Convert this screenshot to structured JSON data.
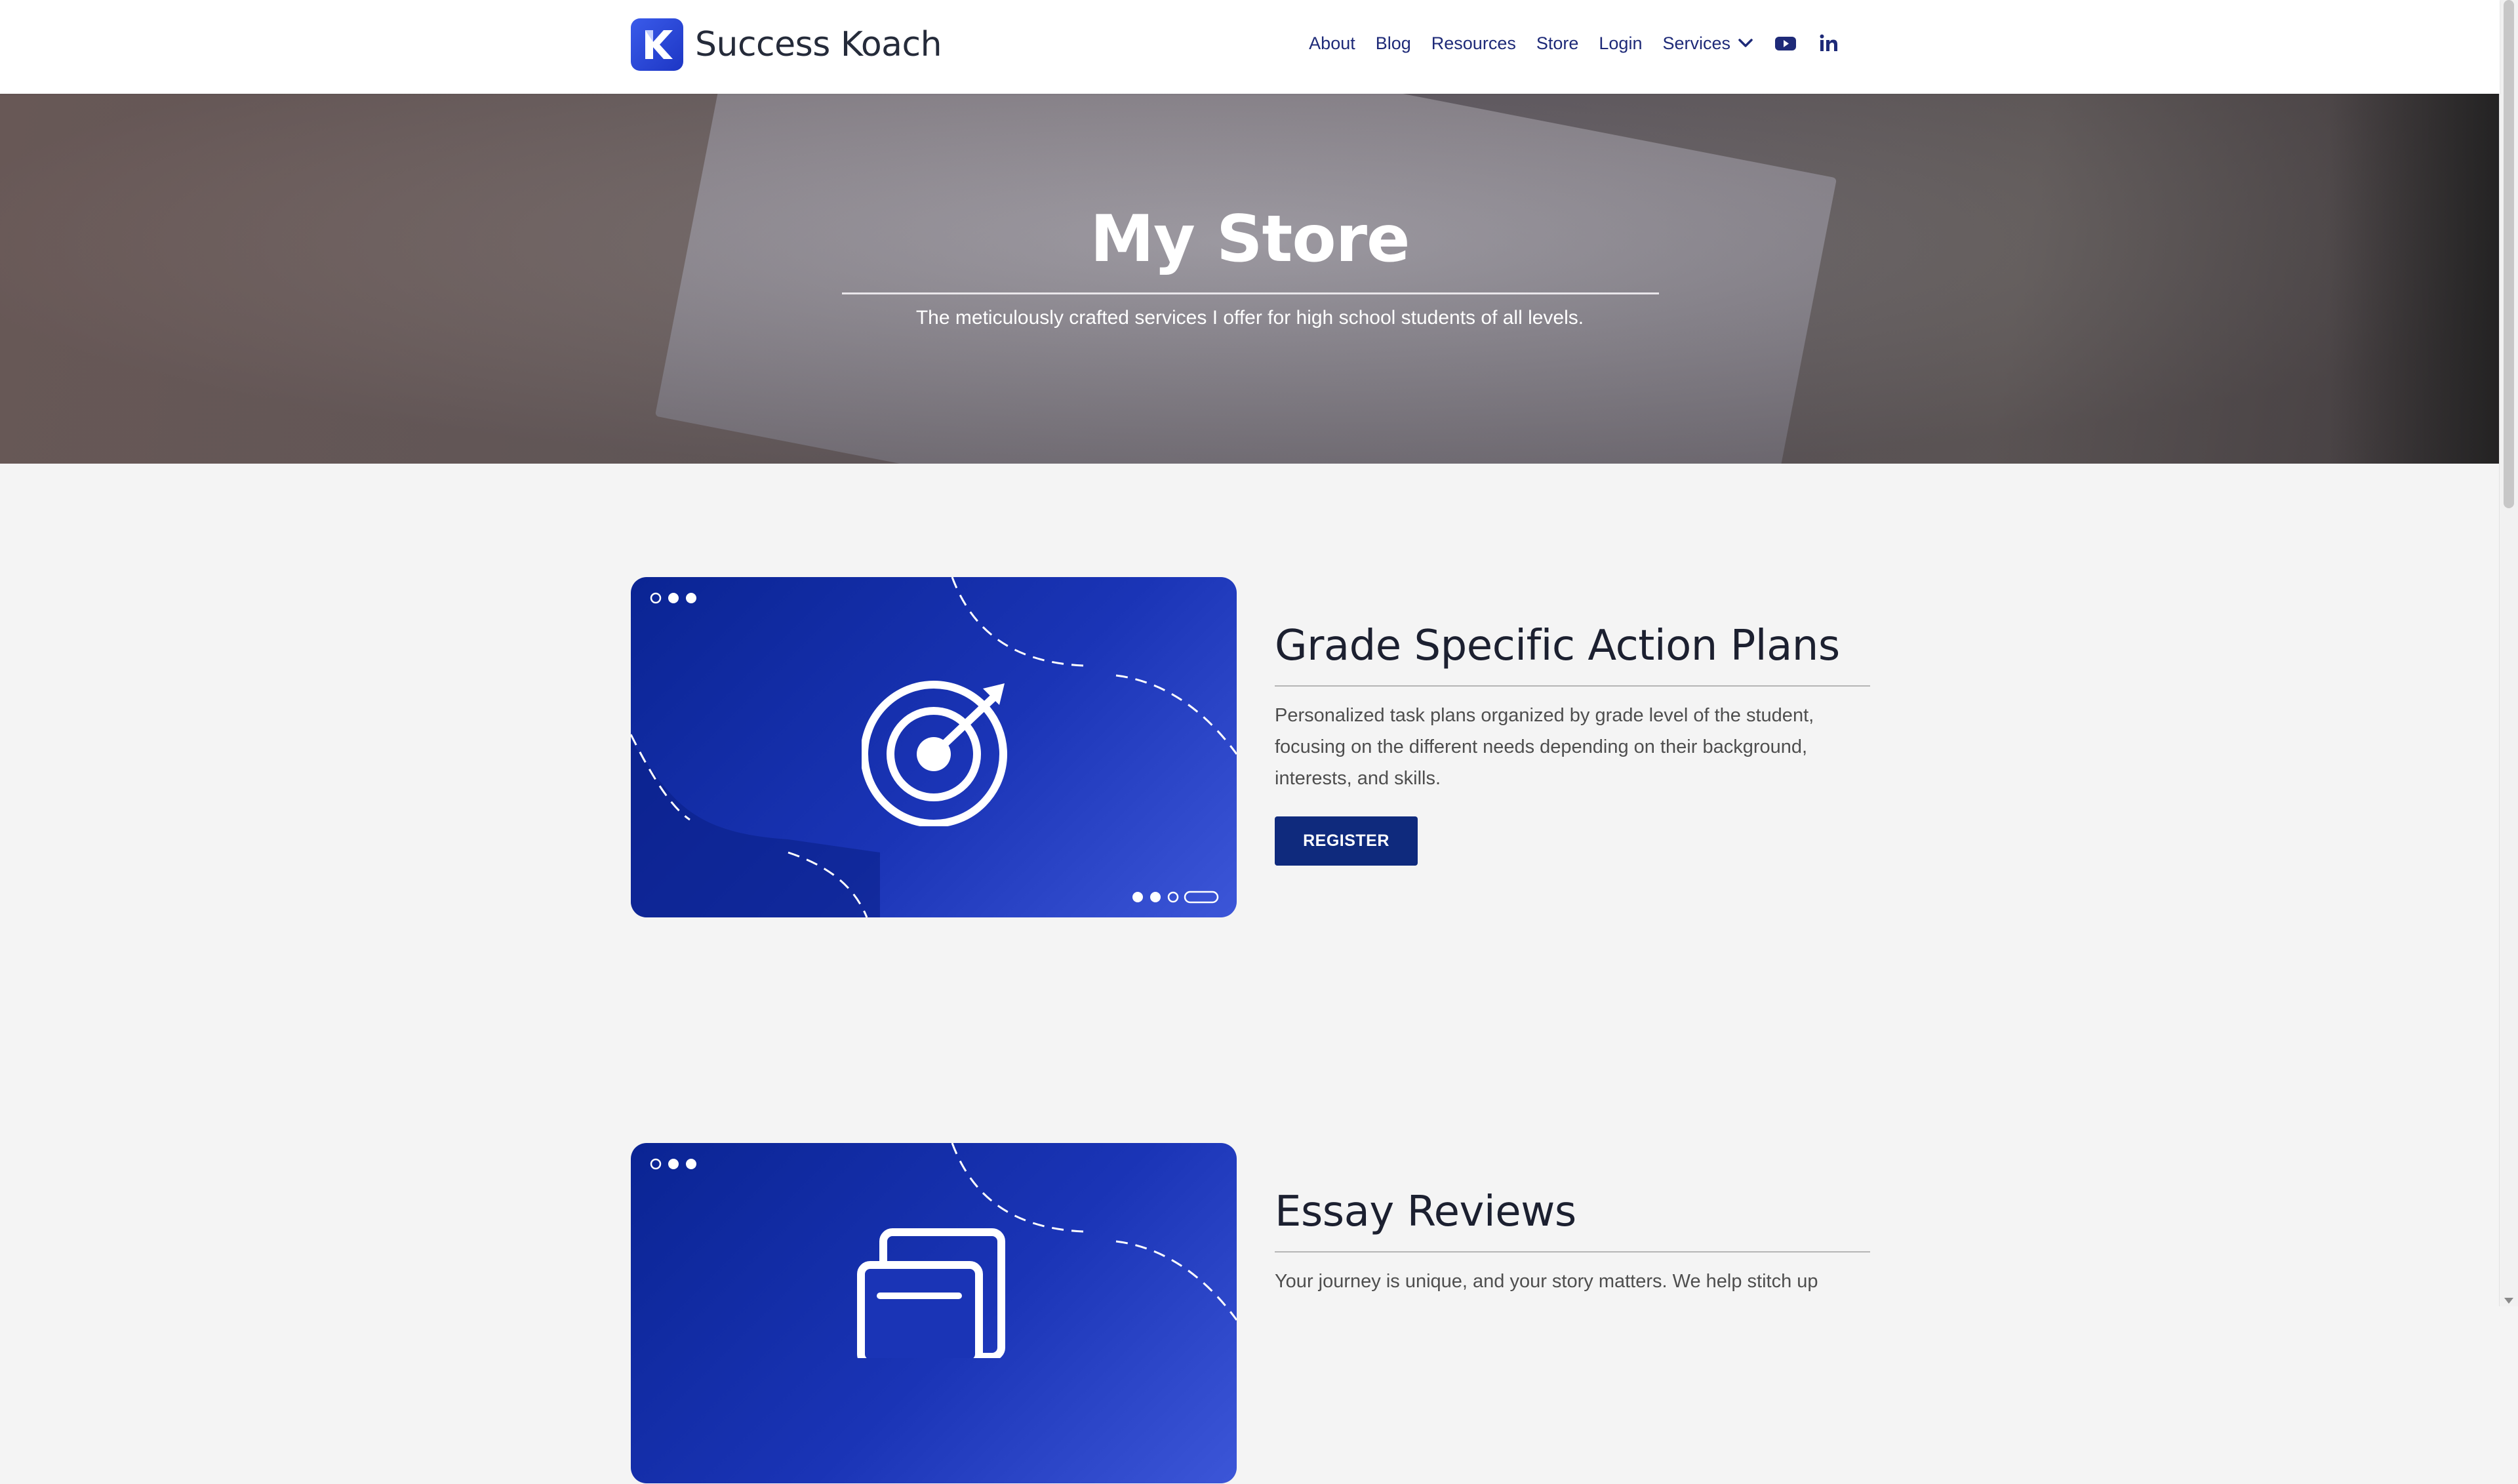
{
  "header": {
    "logo_text": "Success Koach",
    "nav": [
      {
        "label": "About"
      },
      {
        "label": "Blog"
      },
      {
        "label": "Resources"
      },
      {
        "label": "Store"
      },
      {
        "label": "Login"
      }
    ],
    "services_label": "Services",
    "social": [
      "youtube-icon",
      "linkedin-icon"
    ]
  },
  "hero": {
    "title": "My Store",
    "subtitle": "The meticulously crafted services I offer for high school students of all levels."
  },
  "services": [
    {
      "title": "Grade Specific Action Plans",
      "description": "Personalized task plans organized by grade level of the student, focusing on the different needs depending on their background, interests, and skills.",
      "button_label": "REGISTER",
      "icon": "target-icon"
    },
    {
      "title": "Essay Reviews",
      "description": "Your journey is unique, and your story matters. We help stitch up",
      "icon": "documents-icon"
    }
  ],
  "colors": {
    "nav_text": "#1e2a78",
    "brand_blue": "#0f2a7d",
    "card_gradient_start": "#0a2493",
    "card_gradient_end": "#3c56d8"
  }
}
